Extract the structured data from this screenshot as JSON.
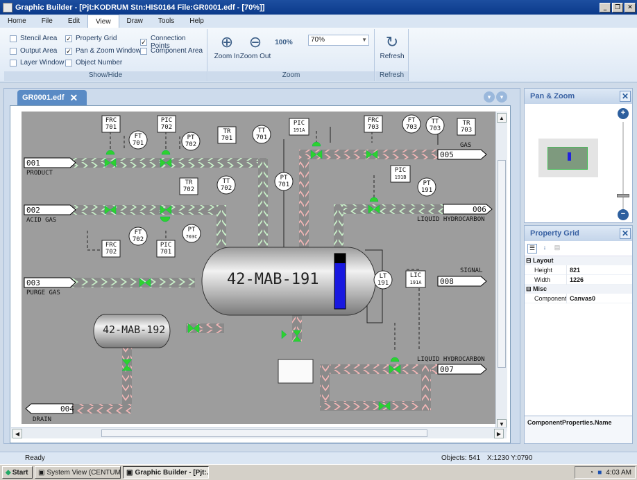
{
  "window": {
    "title": "Graphic Builder - [Pjt:KODRUM Stn:HIS0164 File:GR0001.edf - [70%]]"
  },
  "menu": [
    "Home",
    "File",
    "Edit",
    "View",
    "Draw",
    "Tools",
    "Help"
  ],
  "ribbon": {
    "show_hide": {
      "label": "Show/Hide",
      "items": [
        {
          "label": "Stencil Area",
          "checked": false
        },
        {
          "label": "Output Area",
          "checked": false
        },
        {
          "label": "Layer Window",
          "checked": false
        },
        {
          "label": "Property Grid",
          "checked": true
        },
        {
          "label": "Pan & Zoom Window",
          "checked": true
        },
        {
          "label": "Object Number",
          "checked": false
        },
        {
          "label": "Connection Points",
          "checked": true
        },
        {
          "label": "Component Area",
          "checked": false
        }
      ]
    },
    "zoom": {
      "label": "Zoom",
      "zoom_in": "Zoom In",
      "zoom_out": "Zoom Out",
      "percent_icon": "100%",
      "value": "70%"
    },
    "refresh": {
      "label": "Refresh",
      "button": "Refresh"
    }
  },
  "document_tab": "GR0001.edf",
  "graphic": {
    "vessel_main": "42-MAB-191",
    "vessel_small": "42-MAB-192",
    "streams": [
      {
        "num": "001",
        "label": "PRODUCT"
      },
      {
        "num": "002",
        "label": "ACID GAS"
      },
      {
        "num": "003",
        "label": "PURGE GAS"
      },
      {
        "num": "004",
        "label": "DRAIN"
      },
      {
        "num": "005",
        "label": "GAS"
      },
      {
        "num": "006",
        "label": "LIQUID HYDROCARBON"
      },
      {
        "num": "008",
        "label": "SIGNAL"
      },
      {
        "num": "007",
        "label": "LIQUID HYDROCARBON"
      }
    ],
    "instruments": [
      {
        "t": "FRC",
        "n": "701",
        "shape": "sq"
      },
      {
        "t": "PIC",
        "n": "702",
        "shape": "sq"
      },
      {
        "t": "FT",
        "n": "701",
        "shape": "c"
      },
      {
        "t": "PT",
        "n": "702",
        "shape": "c"
      },
      {
        "t": "TR",
        "n": "701",
        "shape": "sq"
      },
      {
        "t": "TT",
        "n": "701",
        "shape": "c"
      },
      {
        "t": "PIC",
        "n": "191A",
        "shape": "sq"
      },
      {
        "t": "FRC",
        "n": "703",
        "shape": "sq"
      },
      {
        "t": "FT",
        "n": "703",
        "shape": "c"
      },
      {
        "t": "TT",
        "n": "703",
        "shape": "c"
      },
      {
        "t": "TR",
        "n": "703",
        "shape": "sq"
      },
      {
        "t": "TR",
        "n": "702",
        "shape": "sq"
      },
      {
        "t": "TT",
        "n": "702",
        "shape": "c"
      },
      {
        "t": "PT",
        "n": "701",
        "shape": "c"
      },
      {
        "t": "PIC",
        "n": "191B",
        "shape": "sq"
      },
      {
        "t": "PT",
        "n": "191",
        "shape": "c"
      },
      {
        "t": "FT",
        "n": "702",
        "shape": "c"
      },
      {
        "t": "PT",
        "n": "703C",
        "shape": "c"
      },
      {
        "t": "FRC",
        "n": "702",
        "shape": "sq"
      },
      {
        "t": "PIC",
        "n": "701",
        "shape": "sq"
      },
      {
        "t": "LT",
        "n": "191",
        "shape": "c"
      },
      {
        "t": "LIC",
        "n": "191A",
        "shape": "sq"
      }
    ]
  },
  "pan_zoom": {
    "title": "Pan & Zoom"
  },
  "property_grid": {
    "title": "Property Grid",
    "categories": [
      {
        "name": "Layout",
        "rows": [
          {
            "key": "Height",
            "value": "821"
          },
          {
            "key": "Width",
            "value": "1226"
          }
        ]
      },
      {
        "name": "Misc",
        "rows": [
          {
            "key": "ComponentPr",
            "value": "Canvas0"
          }
        ]
      }
    ],
    "description": "ComponentProperties.Name"
  },
  "status": {
    "text": "Ready",
    "objects": "Objects: 541",
    "coords": "X:1230  Y:0790"
  },
  "taskbar": {
    "start": "Start",
    "items": [
      "System View (CENTUM V...",
      "Graphic Builder - [Pjt:..."
    ],
    "time": "4:03 AM"
  }
}
